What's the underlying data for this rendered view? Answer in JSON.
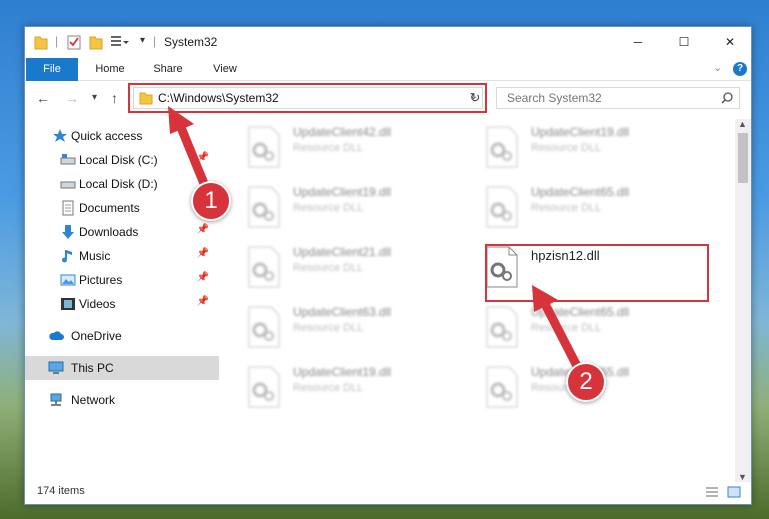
{
  "window": {
    "title": "System32",
    "controls": {
      "minimize": "─",
      "maximize": "☐",
      "close": "✕"
    }
  },
  "ribbon": {
    "tabs": [
      {
        "label": "File"
      },
      {
        "label": "Home"
      },
      {
        "label": "Share"
      },
      {
        "label": "View"
      }
    ]
  },
  "address": {
    "path": "C:\\Windows\\System32"
  },
  "search": {
    "placeholder": "Search System32"
  },
  "nav": {
    "items": [
      {
        "label": "Quick access",
        "icon": "star-icon",
        "pinned": false
      },
      {
        "label": "Local Disk (C:)",
        "icon": "drive-icon",
        "pinned": true
      },
      {
        "label": "Local Disk (D:)",
        "icon": "drive-icon",
        "pinned": false
      },
      {
        "label": "Documents",
        "icon": "documents-icon",
        "pinned": false
      },
      {
        "label": "Downloads",
        "icon": "downloads-icon",
        "pinned": true
      },
      {
        "label": "Music",
        "icon": "music-icon",
        "pinned": true
      },
      {
        "label": "Pictures",
        "icon": "pictures-icon",
        "pinned": true
      },
      {
        "label": "Videos",
        "icon": "videos-icon",
        "pinned": true
      },
      {
        "label": "OneDrive",
        "icon": "cloud-icon",
        "pinned": false
      },
      {
        "label": "This PC",
        "icon": "pc-icon",
        "pinned": false,
        "selected": true
      },
      {
        "label": "Network",
        "icon": "network-icon",
        "pinned": false
      }
    ]
  },
  "files": [
    {
      "name": "UpdateClient42.dll",
      "type": "Resource DLL",
      "highlighted": false
    },
    {
      "name": "UpdateClient19.dll",
      "type": "Resource DLL",
      "highlighted": false
    },
    {
      "name": "UpdateClient19.dll",
      "type": "Resource DLL",
      "highlighted": false
    },
    {
      "name": "UpdateClient65.dll",
      "type": "Resource DLL",
      "highlighted": false
    },
    {
      "name": "UpdateClient21.dll",
      "type": "Resource DLL",
      "highlighted": false
    },
    {
      "name": "hpzisn12.dll",
      "type": "",
      "highlighted": true
    },
    {
      "name": "UpdateClient63.dll",
      "type": "Resource DLL",
      "highlighted": false
    },
    {
      "name": "UpdateClient65.dll",
      "type": "Resource DLL",
      "highlighted": false
    },
    {
      "name": "UpdateClient19.dll",
      "type": "Resource DLL",
      "highlighted": false
    },
    {
      "name": "UpdateClient65.dll",
      "type": "Resource DLL",
      "highlighted": false
    }
  ],
  "status": {
    "item_count": "174 items"
  },
  "annotations": {
    "step1": "1",
    "step2": "2"
  },
  "colors": {
    "accent": "#1979ca",
    "highlight": "#d6333b"
  }
}
